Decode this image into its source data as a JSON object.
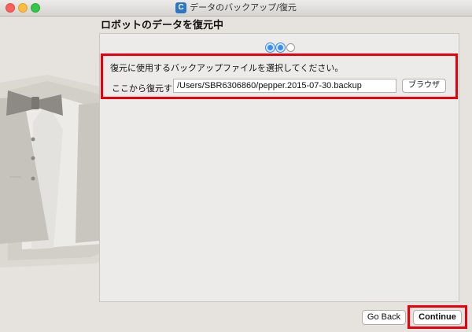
{
  "window": {
    "icon_letter": "C",
    "title": "データのバックアップ/復元"
  },
  "page": {
    "heading": "ロボットのデータを復元中"
  },
  "steps": {
    "total": 3,
    "current": 2
  },
  "form": {
    "instruction": "復元に使用するバックアップファイルを選択してください。",
    "path_label": "ここから復元する:",
    "path_value": "/Users/SBR6306860/pepper.2015-07-30.backup",
    "browse_label": "ブラウザ"
  },
  "footer": {
    "go_back_label": "Go Back",
    "continue_label": "Continue"
  },
  "colors": {
    "highlight": "#e8000b",
    "step_active": "#3b8ef0"
  },
  "decorative_image": "tuxedo-bowtie-illustration"
}
